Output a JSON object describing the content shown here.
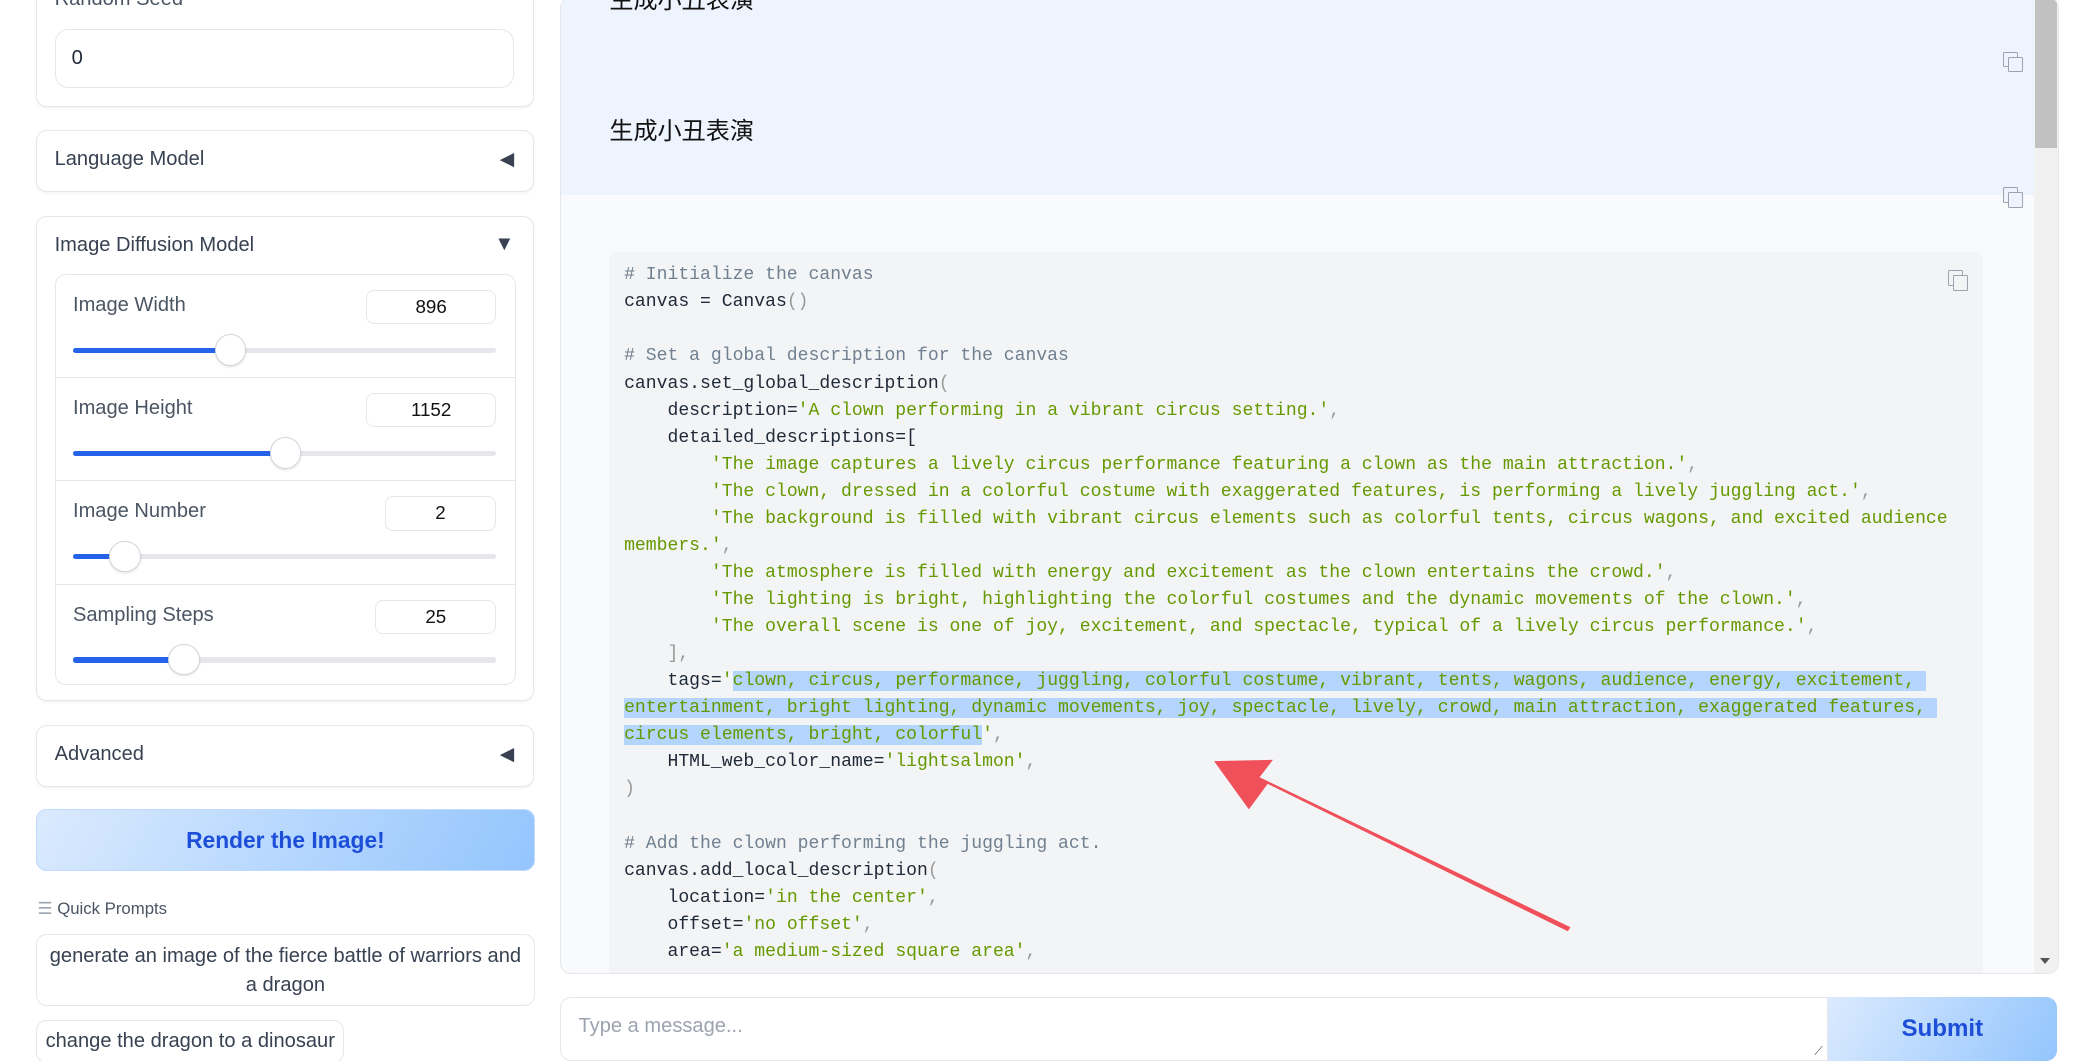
{
  "sidebar": {
    "random_seed": {
      "label": "Random Seed",
      "value": "0"
    },
    "language_model": {
      "label": "Language Model",
      "icon": "triangle-left-icon"
    },
    "image_diffusion": {
      "label": "Image Diffusion Model",
      "icon": "triangle-down-icon",
      "sliders": [
        {
          "label": "Image Width",
          "value": "896",
          "fraction": 0.37
        },
        {
          "label": "Image Height",
          "value": "1152",
          "fraction": 0.5
        },
        {
          "label": "Image Number",
          "value": "2",
          "fraction": 0.12
        },
        {
          "label": "Sampling Steps",
          "value": "25",
          "fraction": 0.26
        }
      ]
    },
    "advanced": {
      "label": "Advanced",
      "icon": "triangle-left-icon"
    },
    "render_button": "Render the Image!",
    "quick_prompts": {
      "label": "Quick Prompts",
      "items": [
        "generate an image of the fierce battle of warriors and a dragon",
        "change the dragon to a dinosaur"
      ]
    }
  },
  "chat": {
    "user_messages": [
      "生成小丑表演",
      "生成小丑表演"
    ],
    "code_lines": [
      [
        [
          "c",
          "# Initialize the canvas"
        ]
      ],
      [
        [
          "n",
          "canvas = Canvas"
        ],
        [
          "p",
          "()"
        ]
      ],
      [
        [
          "n",
          ""
        ]
      ],
      [
        [
          "c",
          "# Set a global description for the canvas"
        ]
      ],
      [
        [
          "n",
          "canvas.set_global_description"
        ],
        [
          "p",
          "("
        ]
      ],
      [
        [
          "n",
          "    description="
        ],
        [
          "s",
          "'A clown performing in a vibrant circus setting.'"
        ],
        [
          "p",
          ","
        ]
      ],
      [
        [
          "n",
          "    detailed_descriptions=["
        ]
      ],
      [
        [
          "n",
          "        "
        ],
        [
          "s",
          "'The image captures a lively circus performance featuring a clown as the main attraction.'"
        ],
        [
          "p",
          ","
        ]
      ],
      [
        [
          "n",
          "        "
        ],
        [
          "s",
          "'The clown, dressed in a colorful costume with exaggerated features, is performing a lively juggling act.'"
        ],
        [
          "p",
          ","
        ]
      ],
      [
        [
          "n",
          "        "
        ],
        [
          "s",
          "'The background is filled with vibrant circus elements such as colorful tents, circus wagons, and excited audience members.'"
        ],
        [
          "p",
          ","
        ]
      ],
      [
        [
          "n",
          "        "
        ],
        [
          "s",
          "'The atmosphere is filled with energy and excitement as the clown entertains the crowd.'"
        ],
        [
          "p",
          ","
        ]
      ],
      [
        [
          "n",
          "        "
        ],
        [
          "s",
          "'The lighting is bright, highlighting the colorful costumes and the dynamic movements of the clown.'"
        ],
        [
          "p",
          ","
        ]
      ],
      [
        [
          "n",
          "        "
        ],
        [
          "s",
          "'The overall scene is one of joy, excitement, and spectacle, typical of a lively circus performance.'"
        ],
        [
          "p",
          ","
        ]
      ],
      [
        [
          "p",
          "    ],"
        ]
      ],
      [
        [
          "n",
          "    tags="
        ],
        [
          "s",
          "'"
        ],
        [
          "sel",
          "clown, circus, performance, juggling, colorful costume, vibrant, tents, wagons, audience, energy, excitement, entertainment, bright lighting, dynamic movements, joy, spectacle, lively, crowd, main attraction, exaggerated features, circus elements, bright, colorful"
        ],
        [
          "s",
          "'"
        ],
        [
          "p",
          ","
        ]
      ],
      [
        [
          "n",
          "    HTML_web_color_name="
        ],
        [
          "s",
          "'lightsalmon'"
        ],
        [
          "p",
          ","
        ]
      ],
      [
        [
          "p",
          ")"
        ]
      ],
      [
        [
          "n",
          ""
        ]
      ],
      [
        [
          "c",
          "# Add the clown performing the juggling act."
        ]
      ],
      [
        [
          "n",
          "canvas.add_local_description"
        ],
        [
          "p",
          "("
        ]
      ],
      [
        [
          "n",
          "    location="
        ],
        [
          "s",
          "'in the center'"
        ],
        [
          "p",
          ","
        ]
      ],
      [
        [
          "n",
          "    offset="
        ],
        [
          "s",
          "'no offset'"
        ],
        [
          "p",
          ","
        ]
      ],
      [
        [
          "n",
          "    area="
        ],
        [
          "s",
          "'a medium-sized square area'"
        ],
        [
          "p",
          ","
        ]
      ]
    ],
    "input_placeholder": "Type a message...",
    "submit_label": "Submit"
  },
  "colors": {
    "accent": "#2563eb",
    "annotation_arrow": "#f0505a"
  }
}
